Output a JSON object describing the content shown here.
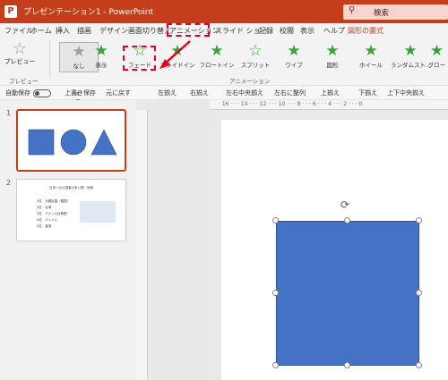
{
  "titlebar": {
    "title": "プレゼンテーション1 - PowerPoint",
    "search_placeholder": "検索",
    "logo": "P"
  },
  "tabs": [
    "ファイル",
    "ホーム",
    "挿入",
    "描画",
    "デザイン",
    "画面切り替え",
    "アニメーション",
    "スライド ショー",
    "記録",
    "校閲",
    "表示",
    "ヘルプ",
    "図形の書式"
  ],
  "ribbon": {
    "preview": {
      "label": "プレビュー",
      "group_label": "プレビュー"
    },
    "animation_group_label": "アニメーション",
    "animations": [
      {
        "label": "なし",
        "icon": "none-star-icon",
        "selected": true
      },
      {
        "label": "表示",
        "icon": "star-icon"
      },
      {
        "label": "フェード",
        "icon": "star-icon"
      },
      {
        "label": "スライドイン",
        "icon": "star-icon"
      },
      {
        "label": "フロートイン",
        "icon": "star-icon"
      },
      {
        "label": "スプリット",
        "icon": "star-icon"
      },
      {
        "label": "ワイプ",
        "icon": "star-icon"
      },
      {
        "label": "図形",
        "icon": "star-icon"
      },
      {
        "label": "ホイール",
        "icon": "star-icon"
      },
      {
        "label": "ランダムスト...",
        "icon": "star-icon"
      },
      {
        "label": "グロー",
        "icon": "star-icon"
      }
    ]
  },
  "qat": {
    "autosave": "自動保存",
    "autosave_state": "オフ",
    "items": [
      "上書き保存",
      "元に戻す",
      "左揃え",
      "右揃え",
      "左右中央揃え",
      "左右に整列",
      "上揃え",
      "下揃え",
      "上下中央揃え"
    ]
  },
  "slides": [
    {
      "number": "1"
    },
    {
      "number": "2",
      "title": "日本への入国者の多い国・地域",
      "lines": [
        "1位　大韓民国（韓国）",
        "2位　台湾",
        "3位　アメリカ合衆国",
        "4位　ベトナム",
        "5位　香港"
      ]
    }
  ],
  "ruler": {
    "marks": "· 16 · · · 14 · · · 12 · · · 10 · · · 8 · · · 6 · · · 4 · · · 2 · · · 0"
  },
  "colors": {
    "accent": "#c43e1c",
    "shape_fill": "#4472c4",
    "highlight": "#e4001e",
    "anim_star": "#3aa23a"
  }
}
